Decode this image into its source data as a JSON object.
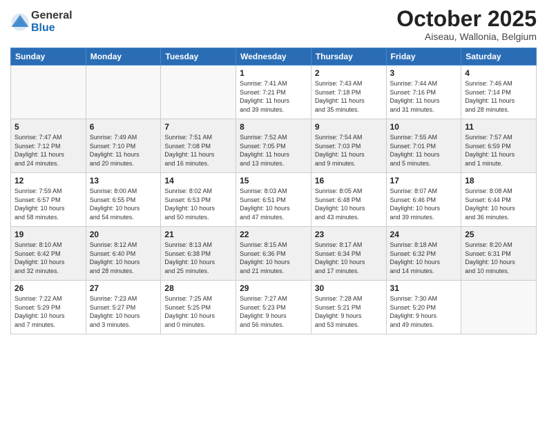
{
  "logo": {
    "general": "General",
    "blue": "Blue"
  },
  "header": {
    "month_title": "October 2025",
    "location": "Aiseau, Wallonia, Belgium"
  },
  "weekdays": [
    "Sunday",
    "Monday",
    "Tuesday",
    "Wednesday",
    "Thursday",
    "Friday",
    "Saturday"
  ],
  "weeks": [
    [
      {
        "day": "",
        "info": ""
      },
      {
        "day": "",
        "info": ""
      },
      {
        "day": "",
        "info": ""
      },
      {
        "day": "1",
        "info": "Sunrise: 7:41 AM\nSunset: 7:21 PM\nDaylight: 11 hours\nand 39 minutes."
      },
      {
        "day": "2",
        "info": "Sunrise: 7:43 AM\nSunset: 7:18 PM\nDaylight: 11 hours\nand 35 minutes."
      },
      {
        "day": "3",
        "info": "Sunrise: 7:44 AM\nSunset: 7:16 PM\nDaylight: 11 hours\nand 31 minutes."
      },
      {
        "day": "4",
        "info": "Sunrise: 7:46 AM\nSunset: 7:14 PM\nDaylight: 11 hours\nand 28 minutes."
      }
    ],
    [
      {
        "day": "5",
        "info": "Sunrise: 7:47 AM\nSunset: 7:12 PM\nDaylight: 11 hours\nand 24 minutes."
      },
      {
        "day": "6",
        "info": "Sunrise: 7:49 AM\nSunset: 7:10 PM\nDaylight: 11 hours\nand 20 minutes."
      },
      {
        "day": "7",
        "info": "Sunrise: 7:51 AM\nSunset: 7:08 PM\nDaylight: 11 hours\nand 16 minutes."
      },
      {
        "day": "8",
        "info": "Sunrise: 7:52 AM\nSunset: 7:05 PM\nDaylight: 11 hours\nand 13 minutes."
      },
      {
        "day": "9",
        "info": "Sunrise: 7:54 AM\nSunset: 7:03 PM\nDaylight: 11 hours\nand 9 minutes."
      },
      {
        "day": "10",
        "info": "Sunrise: 7:55 AM\nSunset: 7:01 PM\nDaylight: 11 hours\nand 5 minutes."
      },
      {
        "day": "11",
        "info": "Sunrise: 7:57 AM\nSunset: 6:59 PM\nDaylight: 11 hours\nand 1 minute."
      }
    ],
    [
      {
        "day": "12",
        "info": "Sunrise: 7:59 AM\nSunset: 6:57 PM\nDaylight: 10 hours\nand 58 minutes."
      },
      {
        "day": "13",
        "info": "Sunrise: 8:00 AM\nSunset: 6:55 PM\nDaylight: 10 hours\nand 54 minutes."
      },
      {
        "day": "14",
        "info": "Sunrise: 8:02 AM\nSunset: 6:53 PM\nDaylight: 10 hours\nand 50 minutes."
      },
      {
        "day": "15",
        "info": "Sunrise: 8:03 AM\nSunset: 6:51 PM\nDaylight: 10 hours\nand 47 minutes."
      },
      {
        "day": "16",
        "info": "Sunrise: 8:05 AM\nSunset: 6:48 PM\nDaylight: 10 hours\nand 43 minutes."
      },
      {
        "day": "17",
        "info": "Sunrise: 8:07 AM\nSunset: 6:46 PM\nDaylight: 10 hours\nand 39 minutes."
      },
      {
        "day": "18",
        "info": "Sunrise: 8:08 AM\nSunset: 6:44 PM\nDaylight: 10 hours\nand 36 minutes."
      }
    ],
    [
      {
        "day": "19",
        "info": "Sunrise: 8:10 AM\nSunset: 6:42 PM\nDaylight: 10 hours\nand 32 minutes."
      },
      {
        "day": "20",
        "info": "Sunrise: 8:12 AM\nSunset: 6:40 PM\nDaylight: 10 hours\nand 28 minutes."
      },
      {
        "day": "21",
        "info": "Sunrise: 8:13 AM\nSunset: 6:38 PM\nDaylight: 10 hours\nand 25 minutes."
      },
      {
        "day": "22",
        "info": "Sunrise: 8:15 AM\nSunset: 6:36 PM\nDaylight: 10 hours\nand 21 minutes."
      },
      {
        "day": "23",
        "info": "Sunrise: 8:17 AM\nSunset: 6:34 PM\nDaylight: 10 hours\nand 17 minutes."
      },
      {
        "day": "24",
        "info": "Sunrise: 8:18 AM\nSunset: 6:32 PM\nDaylight: 10 hours\nand 14 minutes."
      },
      {
        "day": "25",
        "info": "Sunrise: 8:20 AM\nSunset: 6:31 PM\nDaylight: 10 hours\nand 10 minutes."
      }
    ],
    [
      {
        "day": "26",
        "info": "Sunrise: 7:22 AM\nSunset: 5:29 PM\nDaylight: 10 hours\nand 7 minutes."
      },
      {
        "day": "27",
        "info": "Sunrise: 7:23 AM\nSunset: 5:27 PM\nDaylight: 10 hours\nand 3 minutes."
      },
      {
        "day": "28",
        "info": "Sunrise: 7:25 AM\nSunset: 5:25 PM\nDaylight: 10 hours\nand 0 minutes."
      },
      {
        "day": "29",
        "info": "Sunrise: 7:27 AM\nSunset: 5:23 PM\nDaylight: 9 hours\nand 56 minutes."
      },
      {
        "day": "30",
        "info": "Sunrise: 7:28 AM\nSunset: 5:21 PM\nDaylight: 9 hours\nand 53 minutes."
      },
      {
        "day": "31",
        "info": "Sunrise: 7:30 AM\nSunset: 5:20 PM\nDaylight: 9 hours\nand 49 minutes."
      },
      {
        "day": "",
        "info": ""
      }
    ]
  ]
}
